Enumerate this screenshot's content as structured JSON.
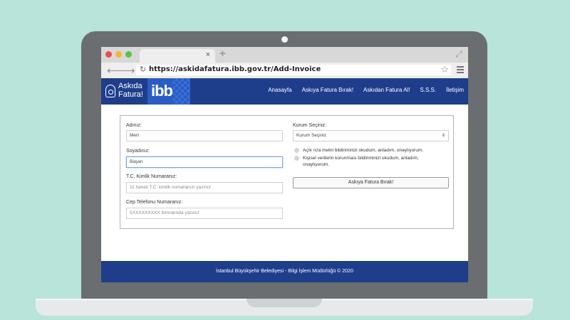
{
  "browser": {
    "tab_close": "×",
    "new_tab": "+",
    "url": "https://askidafatura.ibb.gov.tr/Add-Invoice"
  },
  "site": {
    "logo_line1": "Askıda",
    "logo_line2": "Fatura!",
    "ibb_logo": "ibb",
    "nav": [
      "Anasayfa",
      "Askıya Fatura Bırak!",
      "Askıdan Fatura Al!",
      "S.S.S.",
      "İletişim"
    ]
  },
  "form": {
    "name_label": "Adınız:",
    "name_value": "Mert",
    "surname_label": "Soyadınız:",
    "surname_value": "Başarı",
    "tc_label": "T.C. Kimlik Numaranız:",
    "tc_placeholder": "11 haneli T.C. kimlik numaranızı yazınız",
    "phone_label": "Cep Telefonu Numaranız:",
    "phone_placeholder": "5XXXXXXXXX formatında yazınız",
    "institution_label": "Kurum Seçiniz:",
    "institution_value": "Kurum Seçiniz",
    "consent1": "Açık rıza metni bildiriminizi okudum, anladım, onaylıyorum.",
    "consent2_line1": "Kişisel verilerin korunması bildiriminizi okudum, anladım,",
    "consent2_line2": "onaylıyorum.",
    "submit_label": "Askıya Fatura Bırak!"
  },
  "footer": {
    "text": "İstanbul Büyükşehir Belediyesi - Bilgi İşlem Müdürlüğü © 2020"
  },
  "colors": {
    "background": "#b8e4da",
    "header_blue": "#1e3e8c",
    "ibb_blue": "#2a5cc4"
  }
}
